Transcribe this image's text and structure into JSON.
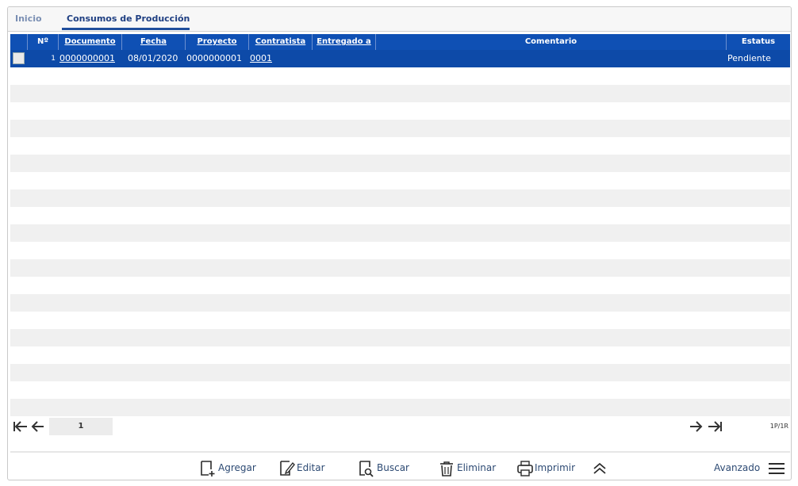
{
  "tabs": [
    {
      "label": "Inicio"
    },
    {
      "label": "Consumos de Producción"
    }
  ],
  "grid": {
    "columns": {
      "num": "Nº",
      "documento": "Documento",
      "fecha": "Fecha",
      "proyecto": "Proyecto",
      "contratista": "Contratista",
      "entregado": "Entregado a",
      "comentario": "Comentario",
      "estatus": "Estatus"
    },
    "rows": [
      {
        "num": "1",
        "documento": "0000000001",
        "fecha": "08/01/2020",
        "proyecto": "0000000001",
        "contratista": "0001",
        "entregado": "",
        "comentario": "",
        "estatus": "Pendiente"
      }
    ]
  },
  "pager": {
    "page": "1",
    "info": "1P/1R"
  },
  "toolbar": {
    "agregar": "Agregar",
    "editar": "Editar",
    "buscar": "Buscar",
    "eliminar": "Eliminar",
    "imprimir": "Imprimir",
    "avanzado": "Avanzado"
  },
  "colors": {
    "header": "#0f50b4",
    "selected_row": "#0d4aa8",
    "accent": "#1f4e9c"
  }
}
